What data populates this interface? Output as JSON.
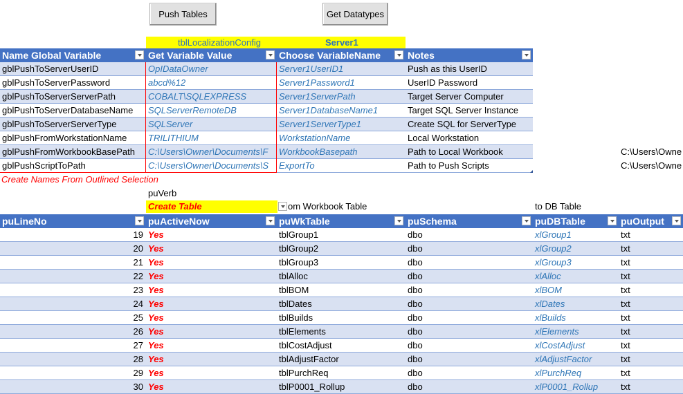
{
  "buttons": {
    "push_tables": "Push Tables",
    "get_datatypes": "Get Datatypes"
  },
  "config": {
    "table_name": "tblLocalizationConfig",
    "server": "Server1",
    "headers": [
      "Name Global Variable",
      "Get Variable Value",
      "Choose VariableName",
      "Notes"
    ],
    "rows": [
      [
        "gblPushToServerUserID",
        "OpIDataOwner",
        "Server1UserID1",
        "Push as this UserID"
      ],
      [
        "gblPushToServerPassword",
        "abcd%12",
        "Server1Password1",
        "UserID Password"
      ],
      [
        "gblPushToServerServerPath",
        "COBALT\\SQLEXPRESS",
        "Server1ServerPath",
        "Target Server Computer"
      ],
      [
        "gblPushToServerDatabaseName",
        "SQLServerRemoteDB",
        "Server1DatabaseName1",
        "Target SQL Server Instance"
      ],
      [
        "gblPushToServerServerType",
        "SQLServer",
        "Server1ServerType1",
        "Create SQL for ServerType"
      ],
      [
        "gblPushFromWorkstationName",
        "TRILITHIUM",
        "WorkstationName",
        "Local Workstation"
      ],
      [
        "gblPushFromWorkbookBasePath",
        "C:\\Users\\Owner\\Documents\\F",
        "WorkbookBasepath",
        "Path to Local Workbook"
      ],
      [
        "gblPushScriptToPath",
        "C:\\Users\\Owner\\Documents\\S",
        "ExportTo",
        "Path to Push Scripts"
      ]
    ],
    "side_values": [
      "C:\\Users\\Owne",
      "C:\\Users\\Owne"
    ],
    "note": "Create Names From Outlined Selection"
  },
  "push": {
    "verb_label": "puVerb",
    "verb_value": "Create Table",
    "from_label": "om Workbook Table",
    "to_label": "to DB Table",
    "headers": [
      "puLineNo",
      "puActiveNow",
      "puWkTable",
      "puSchema",
      "puDBTable",
      "puOutput"
    ],
    "rows": [
      [
        "19",
        "Yes",
        "tblGroup1",
        "dbo",
        "xlGroup1",
        "txt"
      ],
      [
        "20",
        "Yes",
        "tblGroup2",
        "dbo",
        "xlGroup2",
        "txt"
      ],
      [
        "21",
        "Yes",
        "tblGroup3",
        "dbo",
        "xlGroup3",
        "txt"
      ],
      [
        "22",
        "Yes",
        "tblAlloc",
        "dbo",
        "xlAlloc",
        "txt"
      ],
      [
        "23",
        "Yes",
        "tblBOM",
        "dbo",
        "xlBOM",
        "txt"
      ],
      [
        "24",
        "Yes",
        "tblDates",
        "dbo",
        "xlDates",
        "txt"
      ],
      [
        "25",
        "Yes",
        "tblBuilds",
        "dbo",
        "xlBuilds",
        "txt"
      ],
      [
        "26",
        "Yes",
        "tblElements",
        "dbo",
        "xlElements",
        "txt"
      ],
      [
        "27",
        "Yes",
        "tblCostAdjust",
        "dbo",
        "xlCostAdjust",
        "txt"
      ],
      [
        "28",
        "Yes",
        "tblAdjustFactor",
        "dbo",
        "xlAdjustFactor",
        "txt"
      ],
      [
        "29",
        "Yes",
        "tblPurchReq",
        "dbo",
        "xlPurchReq",
        "txt"
      ],
      [
        "30",
        "Yes",
        "tblP0001_Rollup",
        "dbo",
        "xlP0001_Rollup",
        "txt"
      ]
    ]
  }
}
